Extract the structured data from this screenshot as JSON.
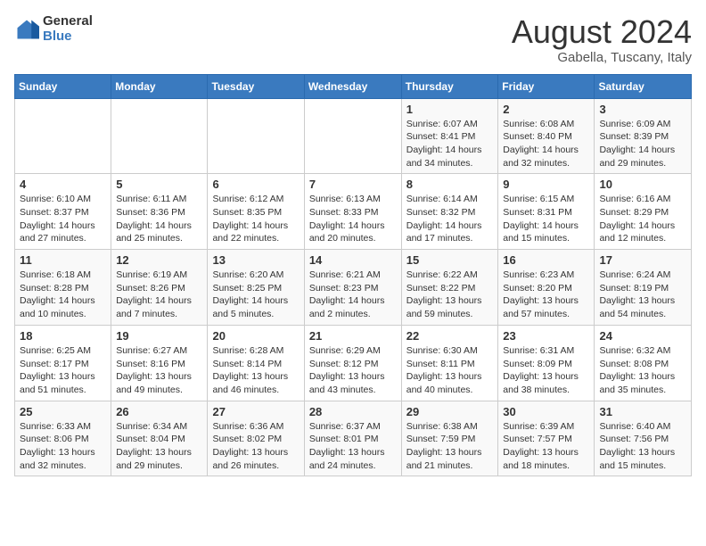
{
  "logo": {
    "general": "General",
    "blue": "Blue"
  },
  "title": {
    "month_year": "August 2024",
    "location": "Gabella, Tuscany, Italy"
  },
  "days_of_week": [
    "Sunday",
    "Monday",
    "Tuesday",
    "Wednesday",
    "Thursday",
    "Friday",
    "Saturday"
  ],
  "weeks": [
    [
      {
        "num": "",
        "info": ""
      },
      {
        "num": "",
        "info": ""
      },
      {
        "num": "",
        "info": ""
      },
      {
        "num": "",
        "info": ""
      },
      {
        "num": "1",
        "info": "Sunrise: 6:07 AM\nSunset: 8:41 PM\nDaylight: 14 hours and 34 minutes."
      },
      {
        "num": "2",
        "info": "Sunrise: 6:08 AM\nSunset: 8:40 PM\nDaylight: 14 hours and 32 minutes."
      },
      {
        "num": "3",
        "info": "Sunrise: 6:09 AM\nSunset: 8:39 PM\nDaylight: 14 hours and 29 minutes."
      }
    ],
    [
      {
        "num": "4",
        "info": "Sunrise: 6:10 AM\nSunset: 8:37 PM\nDaylight: 14 hours and 27 minutes."
      },
      {
        "num": "5",
        "info": "Sunrise: 6:11 AM\nSunset: 8:36 PM\nDaylight: 14 hours and 25 minutes."
      },
      {
        "num": "6",
        "info": "Sunrise: 6:12 AM\nSunset: 8:35 PM\nDaylight: 14 hours and 22 minutes."
      },
      {
        "num": "7",
        "info": "Sunrise: 6:13 AM\nSunset: 8:33 PM\nDaylight: 14 hours and 20 minutes."
      },
      {
        "num": "8",
        "info": "Sunrise: 6:14 AM\nSunset: 8:32 PM\nDaylight: 14 hours and 17 minutes."
      },
      {
        "num": "9",
        "info": "Sunrise: 6:15 AM\nSunset: 8:31 PM\nDaylight: 14 hours and 15 minutes."
      },
      {
        "num": "10",
        "info": "Sunrise: 6:16 AM\nSunset: 8:29 PM\nDaylight: 14 hours and 12 minutes."
      }
    ],
    [
      {
        "num": "11",
        "info": "Sunrise: 6:18 AM\nSunset: 8:28 PM\nDaylight: 14 hours and 10 minutes."
      },
      {
        "num": "12",
        "info": "Sunrise: 6:19 AM\nSunset: 8:26 PM\nDaylight: 14 hours and 7 minutes."
      },
      {
        "num": "13",
        "info": "Sunrise: 6:20 AM\nSunset: 8:25 PM\nDaylight: 14 hours and 5 minutes."
      },
      {
        "num": "14",
        "info": "Sunrise: 6:21 AM\nSunset: 8:23 PM\nDaylight: 14 hours and 2 minutes."
      },
      {
        "num": "15",
        "info": "Sunrise: 6:22 AM\nSunset: 8:22 PM\nDaylight: 13 hours and 59 minutes."
      },
      {
        "num": "16",
        "info": "Sunrise: 6:23 AM\nSunset: 8:20 PM\nDaylight: 13 hours and 57 minutes."
      },
      {
        "num": "17",
        "info": "Sunrise: 6:24 AM\nSunset: 8:19 PM\nDaylight: 13 hours and 54 minutes."
      }
    ],
    [
      {
        "num": "18",
        "info": "Sunrise: 6:25 AM\nSunset: 8:17 PM\nDaylight: 13 hours and 51 minutes."
      },
      {
        "num": "19",
        "info": "Sunrise: 6:27 AM\nSunset: 8:16 PM\nDaylight: 13 hours and 49 minutes."
      },
      {
        "num": "20",
        "info": "Sunrise: 6:28 AM\nSunset: 8:14 PM\nDaylight: 13 hours and 46 minutes."
      },
      {
        "num": "21",
        "info": "Sunrise: 6:29 AM\nSunset: 8:12 PM\nDaylight: 13 hours and 43 minutes."
      },
      {
        "num": "22",
        "info": "Sunrise: 6:30 AM\nSunset: 8:11 PM\nDaylight: 13 hours and 40 minutes."
      },
      {
        "num": "23",
        "info": "Sunrise: 6:31 AM\nSunset: 8:09 PM\nDaylight: 13 hours and 38 minutes."
      },
      {
        "num": "24",
        "info": "Sunrise: 6:32 AM\nSunset: 8:08 PM\nDaylight: 13 hours and 35 minutes."
      }
    ],
    [
      {
        "num": "25",
        "info": "Sunrise: 6:33 AM\nSunset: 8:06 PM\nDaylight: 13 hours and 32 minutes."
      },
      {
        "num": "26",
        "info": "Sunrise: 6:34 AM\nSunset: 8:04 PM\nDaylight: 13 hours and 29 minutes."
      },
      {
        "num": "27",
        "info": "Sunrise: 6:36 AM\nSunset: 8:02 PM\nDaylight: 13 hours and 26 minutes."
      },
      {
        "num": "28",
        "info": "Sunrise: 6:37 AM\nSunset: 8:01 PM\nDaylight: 13 hours and 24 minutes."
      },
      {
        "num": "29",
        "info": "Sunrise: 6:38 AM\nSunset: 7:59 PM\nDaylight: 13 hours and 21 minutes."
      },
      {
        "num": "30",
        "info": "Sunrise: 6:39 AM\nSunset: 7:57 PM\nDaylight: 13 hours and 18 minutes."
      },
      {
        "num": "31",
        "info": "Sunrise: 6:40 AM\nSunset: 7:56 PM\nDaylight: 13 hours and 15 minutes."
      }
    ]
  ]
}
